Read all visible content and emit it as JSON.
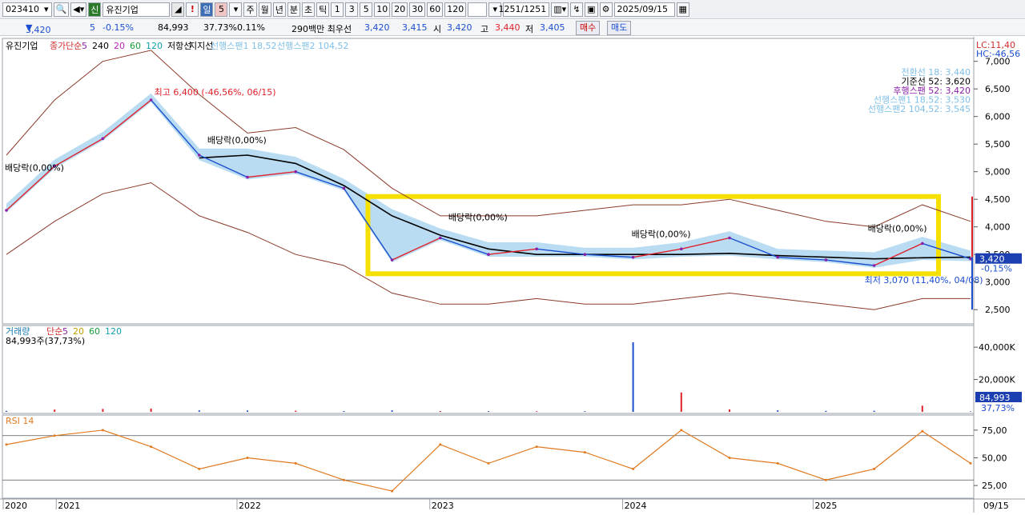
{
  "toolbar": {
    "code": "023410",
    "badge": "신",
    "name": "유진기업",
    "alert": "!",
    "period_sel": "일",
    "period_num": "5",
    "periods": [
      "주",
      "월",
      "년",
      "분",
      "초",
      "틱"
    ],
    "nums": [
      "1",
      "3",
      "5",
      "10",
      "20",
      "30",
      "60",
      "120"
    ],
    "count": "1251",
    "total": "/1251",
    "date": "2025/09/15"
  },
  "quote": {
    "price": "3,420",
    "change": "5",
    "change_pct": "-0.15%",
    "volume": "84,993",
    "vol_pct": "37.73%",
    "turnover": "0.11%",
    "bid_label": "290백만 최우선",
    "bid1": "3,420",
    "bid2": "3,415",
    "open_label": "시",
    "open": "3,420",
    "high_label": "고",
    "high": "3,440",
    "low_label": "저",
    "low": "3,405",
    "buy": "매수",
    "sell": "매도"
  },
  "colors": {
    "up": "#e0202a",
    "down": "#1b4fd0",
    "ma5": "#8b1fa8",
    "ma240": "#000000",
    "ma20": "#c020c0",
    "ma60": "#1a9a3a",
    "ma120": "#12a0b0",
    "env": "#8b3a2a",
    "cloud": "#7fbfe8",
    "cloudGreen": "#8fd080",
    "highlight": "#f5e000",
    "rsi": "#e07a20"
  },
  "chart_data": [
    {
      "type": "line",
      "title": "유진기업",
      "legend": [
        "종가",
        "단순",
        "5",
        "240",
        "20",
        "60",
        "120",
        "저항선",
        "지지선",
        "선행스팬1 18,52",
        "선행스팬2 104,52"
      ],
      "ylim": [
        2300,
        7300
      ],
      "yticks": [
        "7,000",
        "6,500",
        "6,000",
        "5,500",
        "5,000",
        "4,500",
        "4,000",
        "3,500",
        "3,000",
        "2,500"
      ],
      "x": [
        "2020-09",
        "2020-12",
        "2021-03",
        "2021-06",
        "2021-09",
        "2021-12",
        "2022-03",
        "2022-06",
        "2022-09",
        "2022-12",
        "2023-03",
        "2023-06",
        "2023-09",
        "2023-12",
        "2024-03",
        "2024-06",
        "2024-09",
        "2024-12",
        "2025-03",
        "2025-06",
        "2025-09"
      ],
      "close": [
        4300,
        5100,
        5600,
        6300,
        5300,
        4900,
        5000,
        4700,
        3400,
        3800,
        3500,
        3600,
        3500,
        3450,
        3600,
        3800,
        3450,
        3400,
        3300,
        3700,
        3420
      ],
      "ma240": [
        null,
        null,
        null,
        null,
        5250,
        5300,
        5150,
        4750,
        4200,
        3850,
        3600,
        3500,
        3500,
        3500,
        3500,
        3520,
        3480,
        3450,
        3420,
        3440,
        3450
      ],
      "env_upper": [
        5300,
        6300,
        7000,
        7200,
        6400,
        5700,
        5800,
        5400,
        4700,
        4200,
        4200,
        4200,
        4300,
        4400,
        4400,
        4500,
        4300,
        4100,
        4000,
        4400,
        4100
      ],
      "env_lower": [
        3500,
        4100,
        4600,
        4800,
        4200,
        3900,
        3500,
        3300,
        2800,
        2600,
        2600,
        2700,
        2600,
        2600,
        2700,
        2800,
        2700,
        2600,
        2500,
        2700,
        2700
      ],
      "annotations": [
        "최고 6,400 (-46,56%, 06/15)",
        "최저 3,070 (11,40%, 04/08)",
        "배당락(0,00%)",
        "배당락(0,00%)",
        "배당락(0,00%)",
        "배당락(0,00%)",
        "배당락(0,00%)"
      ],
      "right_panel": [
        "LC:11,40",
        "HC:-46,56",
        "전환선 18: 3,440",
        "기준선 52: 3,620",
        "후행스팬 52: 3,420",
        "선행스팬1 18,52: 3,530",
        "선행스팬2 104,52: 3,545"
      ],
      "last_price_tag": "3,420",
      "last_change_tag": "-0,15%",
      "x_labels": [
        "2020",
        "2021",
        "2022",
        "2023",
        "2024",
        "2025",
        "09/15"
      ]
    },
    {
      "type": "bar",
      "title": "거래량",
      "legend": [
        "거래량",
        "단순",
        "5",
        "20",
        "60",
        "120"
      ],
      "current": "84,993주(37,73%)",
      "yticks": [
        "40,000K",
        "20,000K"
      ],
      "ylim": [
        0,
        47000
      ],
      "x": [
        "2020-09",
        "2020-12",
        "2021-03",
        "2021-06",
        "2021-09",
        "2021-12",
        "2022-03",
        "2022-06",
        "2022-09",
        "2022-12",
        "2023-03",
        "2023-06",
        "2023-09",
        "2023-12",
        "2024-03",
        "2024-06",
        "2024-09",
        "2024-12",
        "2025-03",
        "2025-06",
        "2025-09"
      ],
      "values": [
        600,
        1400,
        1800,
        2000,
        900,
        800,
        700,
        500,
        900,
        500,
        400,
        400,
        400,
        43000,
        12000,
        1500,
        900,
        600,
        700,
        3800,
        300
      ],
      "last_tag": "84,993",
      "last_pct": "37,73%"
    },
    {
      "type": "line",
      "title": "RSI 14",
      "ylim": [
        15,
        85
      ],
      "yticks": [
        "75,00",
        "50,00",
        "25,00"
      ],
      "x": [
        "2020-09",
        "2020-12",
        "2021-03",
        "2021-06",
        "2021-09",
        "2021-12",
        "2022-03",
        "2022-06",
        "2022-09",
        "2022-12",
        "2023-03",
        "2023-06",
        "2023-09",
        "2023-12",
        "2024-03",
        "2024-06",
        "2024-09",
        "2024-12",
        "2025-03",
        "2025-06",
        "2025-09"
      ],
      "values": [
        62,
        70,
        75,
        60,
        40,
        50,
        45,
        30,
        20,
        62,
        45,
        60,
        55,
        40,
        75,
        50,
        45,
        30,
        40,
        74,
        45
      ]
    }
  ]
}
